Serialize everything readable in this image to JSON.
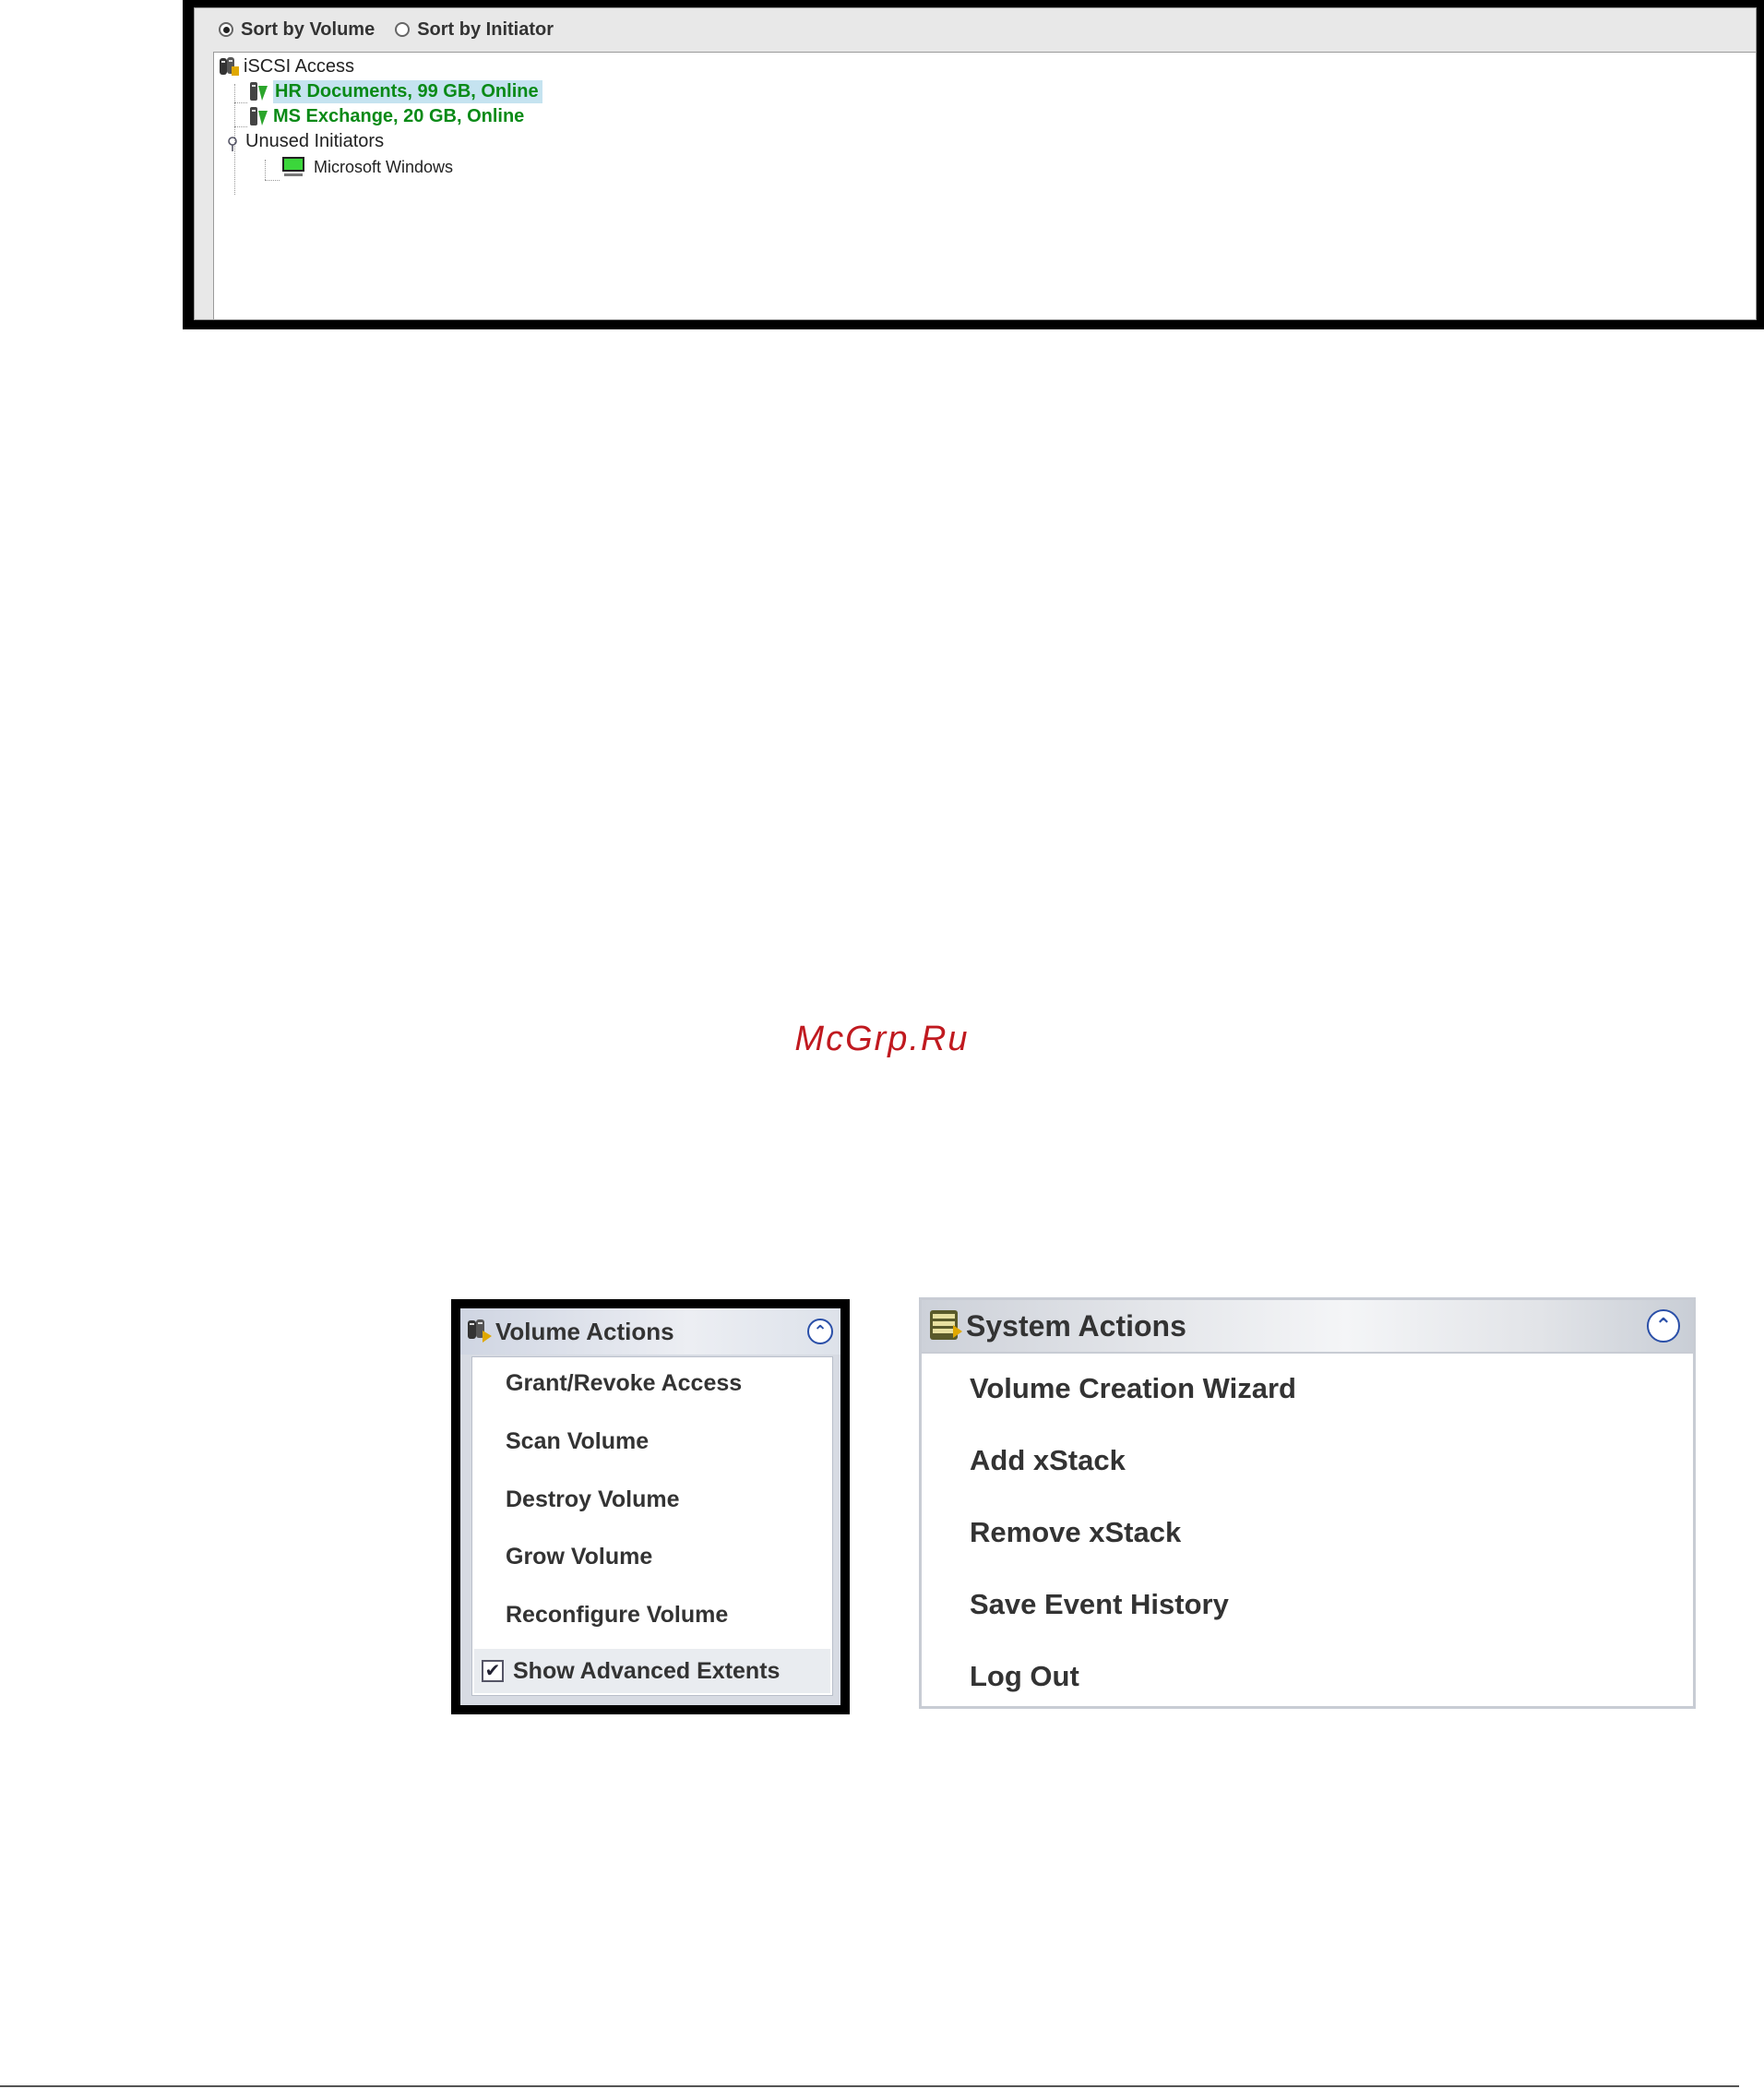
{
  "tree_panel": {
    "sort_options": [
      {
        "label": "Sort by Volume",
        "selected": true
      },
      {
        "label": "Sort by Initiator",
        "selected": false
      }
    ],
    "root_label": "iSCSI Access",
    "volumes": [
      {
        "label": "HR Documents, 99 GB, Online",
        "selected": true
      },
      {
        "label": "MS Exchange, 20 GB, Online",
        "selected": false
      }
    ],
    "unused_group_label": "Unused Initiators",
    "unused_initiators": [
      {
        "label": "Microsoft Windows"
      }
    ]
  },
  "watermark": "McGrp.Ru",
  "volume_actions": {
    "title": "Volume Actions",
    "items": [
      "Grant/Revoke Access",
      "Scan Volume",
      "Destroy Volume",
      "Grow Volume",
      "Reconfigure Volume"
    ],
    "checkbox_label": "Show Advanced Extents",
    "checkbox_checked": true
  },
  "system_actions": {
    "title": "System Actions",
    "items": [
      "Volume Creation Wizard",
      "Add xStack",
      "Remove xStack",
      "Save Event History",
      "Log Out"
    ]
  },
  "colors": {
    "volume_online_text": "#0a8a17",
    "selection_background": "#c5e3f0",
    "collapse_icon": "#2a4fa8",
    "watermark": "#c0191f"
  },
  "icons": {
    "tree_root": "volume-group-icon",
    "volume": "volume-icon",
    "initiator": "computer-icon",
    "collapse": "collapse-up-icon",
    "system": "server-icon"
  }
}
